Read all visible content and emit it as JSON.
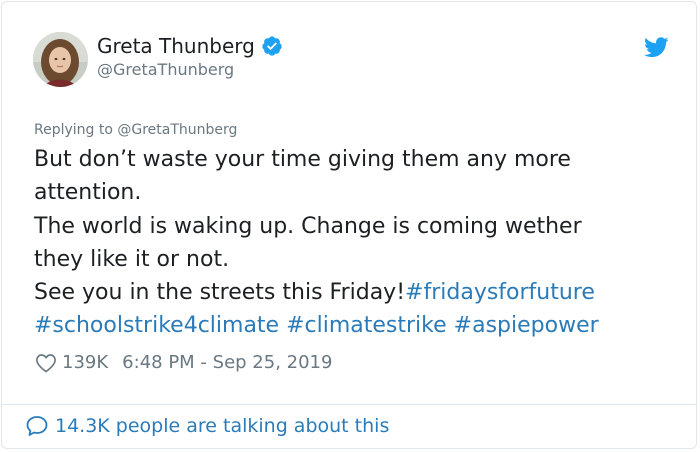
{
  "colors": {
    "link": "#2b7bb9",
    "text": "#1c2022",
    "muted": "#697882",
    "twitter_blue": "#1da1f2",
    "border": "#e1e8ed"
  },
  "author": {
    "name": "Greta Thunberg",
    "handle": "@GretaThunberg",
    "verified_icon": "verified-badge-icon",
    "avatar_icon": "avatar-photo"
  },
  "brand_icon": "twitter-bird-icon",
  "reply_context": {
    "text": "Replying to @GretaThunberg"
  },
  "tweet": {
    "line1": "But don’t waste your time giving them any more",
    "line2": "attention.",
    "line3": "The world is waking up. Change is coming wether",
    "line4": "they like it or not.",
    "line5_text": "See you in the streets this Friday!",
    "hashtags": [
      "#fridaysforfuture",
      "#schoolstrike4climate",
      "#climatestrike",
      "#aspiepower"
    ]
  },
  "meta": {
    "heart_icon": "heart-icon",
    "likes": "139K",
    "timestamp": "6:48 PM - Sep 25, 2019"
  },
  "footer": {
    "bubble_icon": "speech-bubble-icon",
    "talking_text": "14.3K people are talking about this"
  }
}
